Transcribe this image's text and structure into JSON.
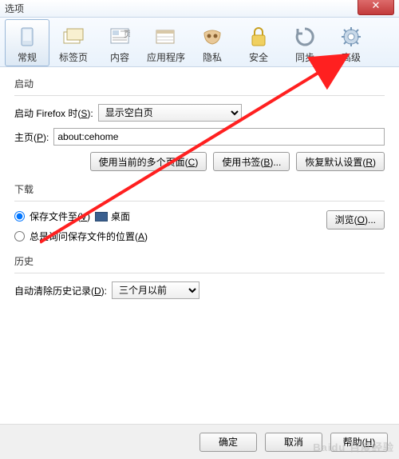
{
  "window": {
    "title": "选项",
    "close": "✕"
  },
  "toolbar": [
    {
      "label": "常规",
      "iconColor": "#6fa8d8"
    },
    {
      "label": "标签页",
      "iconColor": "#d8c87a"
    },
    {
      "label": "内容",
      "iconColor": "#b8c8d8"
    },
    {
      "label": "应用程序",
      "iconColor": "#c8b898"
    },
    {
      "label": "隐私",
      "iconColor": "#d8a870"
    },
    {
      "label": "安全",
      "iconColor": "#d8b850"
    },
    {
      "label": "同步",
      "iconColor": "#8898a8"
    },
    {
      "label": "高级",
      "iconColor": "#7898b8"
    }
  ],
  "startup": {
    "title": "启动",
    "when_label": "启动 Firefox 时(S):",
    "when_value": "显示空白页",
    "home_label": "主页(P):",
    "home_value": "about:cehome",
    "btn_current": "使用当前的多个页面(C)",
    "btn_bookmark": "使用书签(B)...",
    "btn_restore": "恢复默认设置(R)"
  },
  "download": {
    "title": "下载",
    "save_to": "保存文件至(V)",
    "desktop": "桌面",
    "browse": "浏览(O)...",
    "ask": "总是询问保存文件的位置(A)"
  },
  "history": {
    "title": "历史",
    "auto_label": "自动清除历史记录(D):",
    "auto_value": "三个月以前"
  },
  "footer": {
    "ok": "确定",
    "cancel": "取消",
    "help": "帮助(H)"
  },
  "watermark": "Baidu 百度经验"
}
